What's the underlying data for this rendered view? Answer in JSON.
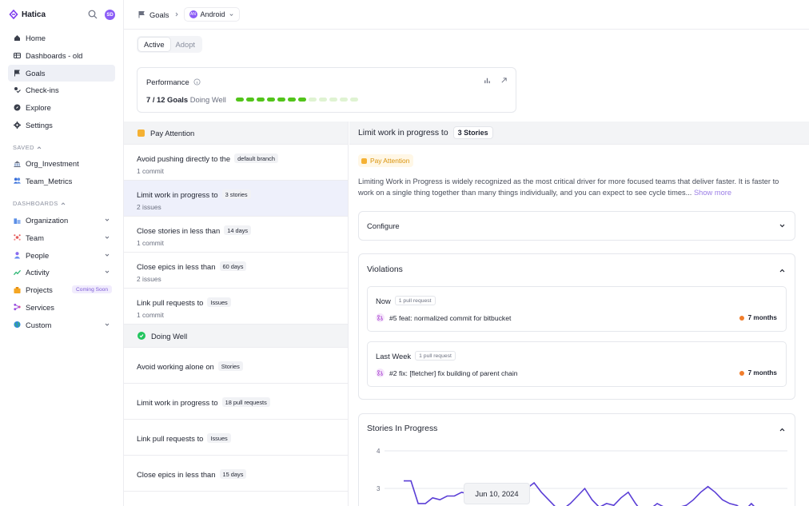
{
  "brand": {
    "name": "Hatica"
  },
  "user": {
    "initials": "SD"
  },
  "sidebar": {
    "main": [
      {
        "label": "Home",
        "icon": "home-icon"
      },
      {
        "label": "Dashboards - old",
        "icon": "dashboard-icon"
      },
      {
        "label": "Goals",
        "icon": "flag-icon",
        "active": true
      },
      {
        "label": "Check-ins",
        "icon": "check-ins-icon"
      },
      {
        "label": "Explore",
        "icon": "compass-icon"
      },
      {
        "label": "Settings",
        "icon": "gear-icon"
      }
    ],
    "saved_label": "SAVED",
    "saved": [
      {
        "label": "Org_Investment",
        "icon": "bank-icon"
      },
      {
        "label": "Team_Metrics",
        "icon": "team-icon"
      }
    ],
    "dashboards_label": "DASHBOARDS",
    "dashboards": [
      {
        "label": "Organization",
        "icon": "organization-icon",
        "chevron": true
      },
      {
        "label": "Team",
        "icon": "team-dots-icon",
        "chevron": true
      },
      {
        "label": "People",
        "icon": "person-icon",
        "chevron": true
      },
      {
        "label": "Activity",
        "icon": "activity-icon",
        "chevron": true
      },
      {
        "label": "Projects",
        "icon": "projects-icon",
        "badge": "Coming Soon"
      },
      {
        "label": "Services",
        "icon": "services-icon"
      },
      {
        "label": "Custom",
        "icon": "globe-icon",
        "chevron": true
      }
    ]
  },
  "header": {
    "crumb": "Goals",
    "team_initials": "AN",
    "team": "Android"
  },
  "tabs": [
    {
      "label": "Active",
      "active": true
    },
    {
      "label": "Adopt"
    }
  ],
  "performance": {
    "title": "Performance",
    "summary_count": "7 / 12 Goals",
    "summary_status": "Doing Well",
    "achieved": 7,
    "total": 12,
    "colors": {
      "done": "#52c41a",
      "pending": "#dff3d2"
    }
  },
  "groups": [
    {
      "title": "Pay Attention",
      "status": "attention",
      "items": [
        {
          "title": "Avoid pushing directly to the",
          "chip": "default branch",
          "sub": "1 commit"
        },
        {
          "title": "Limit work in progress to",
          "chip": "3 stories",
          "sub": "2 issues",
          "selected": true
        },
        {
          "title": "Close stories in less than",
          "chip": "14 days",
          "sub": "1 commit"
        },
        {
          "title": "Close epics in less than",
          "chip": "60 days",
          "sub": "2 issues"
        },
        {
          "title": "Link pull requests to",
          "chip": "Issues",
          "sub": "1 commit"
        }
      ]
    },
    {
      "title": "Doing Well",
      "status": "ok",
      "items": [
        {
          "title": "Avoid working alone on",
          "chip": "Stories"
        },
        {
          "title": "Limit work in progress to",
          "chip": "18 pull requests"
        },
        {
          "title": "Link pull requests to",
          "chip": "Issues"
        },
        {
          "title": "Close epics in less than",
          "chip": "15 days"
        }
      ]
    }
  ],
  "detail": {
    "title": "Limit work in progress to",
    "chip": "3 Stories",
    "badge": "Pay Attention",
    "description": "Limiting Work in Progress is widely recognized as the most critical driver for more focused teams that deliver faster. It is faster to work on a single thing together than many things individually, and you can expect to see cycle times...",
    "show_more": "Show more",
    "configure": "Configure",
    "violations_title": "Violations",
    "violations": [
      {
        "period": "Now",
        "count": "1 pull request",
        "pr": "#5 feat: normalized commit for bitbucket",
        "age": "7 months"
      },
      {
        "period": "Last Week",
        "count": "1 pull request",
        "pr": "#2 fix: [fletcher] fix building of parent chain",
        "age": "7 months"
      }
    ],
    "stories_title": "Stories In Progress",
    "tooltip": "Jun 10, 2024"
  },
  "chart_data": {
    "type": "line",
    "yticks": [
      "4",
      "3"
    ],
    "ylim": [
      2.3,
      4
    ],
    "values": [
      3.2,
      3.2,
      2.6,
      2.6,
      2.75,
      2.7,
      2.8,
      2.8,
      2.9,
      2.85,
      2.85,
      2.85,
      2.75,
      2.7,
      2.7,
      2.85,
      2.8,
      3.0,
      3.15,
      2.9,
      2.7,
      2.5,
      2.45,
      2.6,
      2.8,
      3.0,
      2.7,
      2.5,
      2.6,
      2.55,
      2.75,
      2.9,
      2.6,
      2.35,
      2.45,
      2.6,
      2.5,
      2.4,
      2.5,
      2.55,
      2.7,
      2.9,
      3.05,
      2.9,
      2.7,
      2.6,
      2.55,
      2.4,
      2.6,
      2.4
    ],
    "color": "#5b3fd6"
  }
}
